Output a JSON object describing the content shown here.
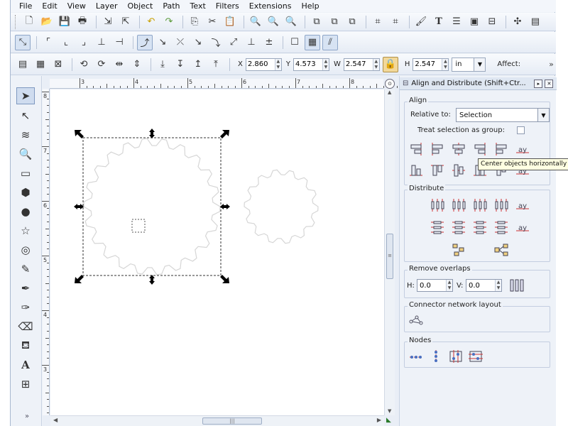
{
  "menu": [
    "File",
    "Edit",
    "View",
    "Layer",
    "Object",
    "Path",
    "Text",
    "Filters",
    "Extensions",
    "Help"
  ],
  "toolbar3": {
    "x_label": "X",
    "x_value": "2.860",
    "y_label": "Y",
    "y_value": "4.573",
    "w_label": "W",
    "w_value": "2.547",
    "h_label": "H",
    "h_value": "2.547",
    "unit": "in",
    "affect": "Affect:",
    "more": "»"
  },
  "rulers": {
    "h_labels": [
      "3",
      "4",
      "5",
      "6",
      "7",
      "8"
    ],
    "v_labels": [
      "8",
      "7",
      "6",
      "5",
      "4",
      "3"
    ]
  },
  "dock": {
    "title": "Align and Distribute (Shift+Ctr...",
    "align_label": "Align",
    "relative_to_label": "Relative to:",
    "relative_to_value": "Selection",
    "treat_group_label": "Treat selection as group:",
    "distribute_label": "Distribute",
    "remove_overlaps_label": "Remove overlaps",
    "h_label": "H:",
    "h_value": "0.0",
    "v_label": "V:",
    "v_value": "0.0",
    "connector_label": "Connector network layout",
    "nodes_label": "Nodes"
  },
  "tooltip": "Center objects horizontally",
  "toolbox_more": "»",
  "colors": {
    "accent": "#7e98c0",
    "lock": "#f2d89a",
    "handle": "#000000"
  }
}
